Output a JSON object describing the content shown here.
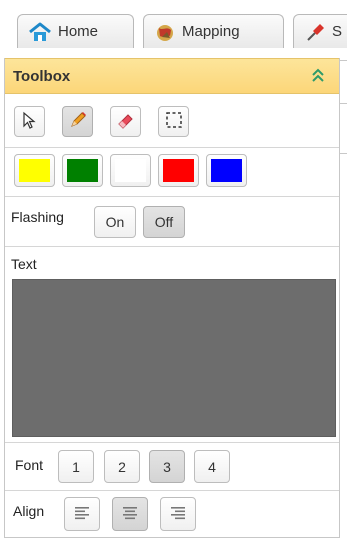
{
  "tabs": [
    {
      "label": "Home",
      "icon": "home-icon"
    },
    {
      "label": "Mapping",
      "icon": "map-icon"
    },
    {
      "label": "S",
      "icon": "pin-icon"
    }
  ],
  "toolbox": {
    "title": "Toolbox",
    "collapse_icon": "double-chevron-up-icon",
    "tools": [
      {
        "name": "select",
        "icon": "pointer-arrow-icon",
        "active": false
      },
      {
        "name": "draw",
        "icon": "pencil-icon",
        "active": true
      },
      {
        "name": "erase",
        "icon": "eraser-icon",
        "active": false
      },
      {
        "name": "region-select",
        "icon": "dashed-rect-icon",
        "active": false
      }
    ],
    "colors": [
      "#ffff00",
      "#008000",
      "#ffffff",
      "#ff0000",
      "#0000ff"
    ],
    "flashing": {
      "label": "Flashing",
      "on": "On",
      "off": "Off",
      "selected": "Off"
    },
    "text": {
      "label": "Text",
      "value": ""
    },
    "font": {
      "label": "Font",
      "options": [
        "1",
        "2",
        "3",
        "4"
      ],
      "selected": "3"
    },
    "align": {
      "label": "Align",
      "options": [
        "left",
        "center",
        "right"
      ],
      "selected": "center"
    }
  }
}
